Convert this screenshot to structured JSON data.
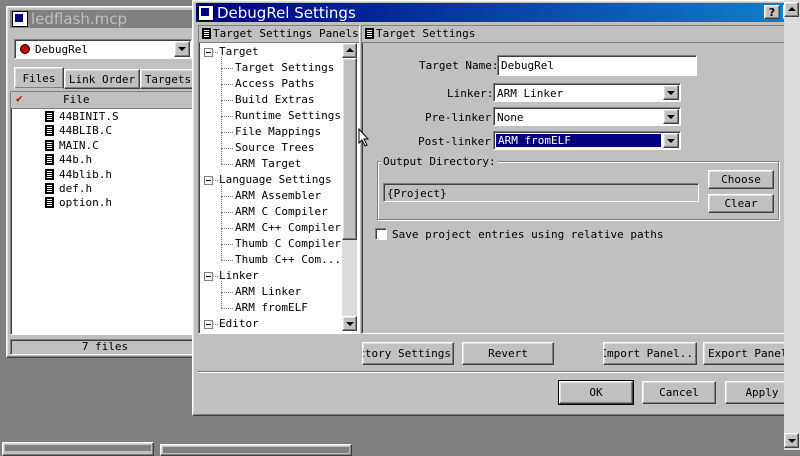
{
  "project_window": {
    "title": "ledflash.mcp",
    "target_select": "DebugRel",
    "tabs": [
      "Files",
      "Link Order",
      "Targets"
    ],
    "file_header": "File",
    "files": [
      "44BINIT.S",
      "44BLIB.C",
      "MAIN.C",
      "44b.h",
      "44blib.h",
      "def.h",
      "option.h"
    ],
    "status": "7 files"
  },
  "dialog": {
    "title": "DebugRel Settings",
    "help_btn": "?",
    "close_btn": "×",
    "panels_header": "Target Settings Panels",
    "panel_title": "Target Settings",
    "tree": [
      {
        "label": "Target",
        "level": 0
      },
      {
        "label": "Target Settings",
        "level": 1
      },
      {
        "label": "Access Paths",
        "level": 1
      },
      {
        "label": "Build Extras",
        "level": 1
      },
      {
        "label": "Runtime Settings",
        "level": 1
      },
      {
        "label": "File Mappings",
        "level": 1
      },
      {
        "label": "Source Trees",
        "level": 1
      },
      {
        "label": "ARM Target",
        "level": 1
      },
      {
        "label": "Language Settings",
        "level": 0
      },
      {
        "label": "ARM Assembler",
        "level": 1
      },
      {
        "label": "ARM C Compiler",
        "level": 1
      },
      {
        "label": "ARM C++ Compiler",
        "level": 1
      },
      {
        "label": "Thumb C Compiler",
        "level": 1
      },
      {
        "label": "Thumb C++ Com...",
        "level": 1
      },
      {
        "label": "Linker",
        "level": 0
      },
      {
        "label": "ARM Linker",
        "level": 1
      },
      {
        "label": "ARM fromELF",
        "level": 1
      },
      {
        "label": "Editor",
        "level": 0
      }
    ],
    "form": {
      "target_name_label": "Target Name:",
      "target_name_value": "DebugRel",
      "linker_label": "Linker:",
      "linker_value": "ARM Linker",
      "prelinker_label": "Pre-linker:",
      "prelinker_value": "None",
      "postlinker_label": "Post-linker:",
      "postlinker_value": "ARM fromELF",
      "output_dir_label": "Output Directory:",
      "output_dir_value": "{Project}",
      "choose_btn": "Choose",
      "clear_btn": "Clear",
      "save_relative_label": "Save project entries using relative paths"
    },
    "buttons": {
      "factory": "Factory Settings",
      "revert": "Revert",
      "import": "Import Panel...",
      "export": "Export Panel...",
      "ok": "OK",
      "cancel": "Cancel",
      "apply": "Apply"
    }
  },
  "taskbar": {
    "item1": "",
    "item2": ""
  }
}
